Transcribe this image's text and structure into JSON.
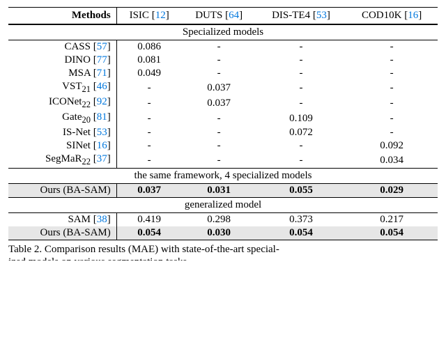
{
  "header": {
    "methods": "Methods",
    "cols": [
      {
        "name": "ISIC",
        "cite": "12"
      },
      {
        "name": "DUTS",
        "cite": "64"
      },
      {
        "name": "DIS-TE4",
        "cite": "53"
      },
      {
        "name": "COD10K",
        "cite": "16"
      }
    ]
  },
  "sections": [
    {
      "title": "Specialized models",
      "shade": false,
      "rows": [
        {
          "name": "CASS",
          "cite": "57",
          "vals": [
            "0.086",
            "-",
            "-",
            "-"
          ],
          "bold": false
        },
        {
          "name": "DINO",
          "cite": "77",
          "vals": [
            "0.081",
            "-",
            "-",
            "-"
          ],
          "bold": false
        },
        {
          "name": "MSA",
          "cite": "71",
          "vals": [
            "0.049",
            "-",
            "-",
            "-"
          ],
          "bold": false
        },
        {
          "name": "VST",
          "sub": "21",
          "cite": "46",
          "vals": [
            "-",
            "0.037",
            "-",
            "-"
          ],
          "bold": false
        },
        {
          "name": "ICONet",
          "sub": "22",
          "cite": "92",
          "vals": [
            "-",
            "0.037",
            "-",
            "-"
          ],
          "bold": false
        },
        {
          "name": "Gate",
          "sub": "20",
          "cite": "81",
          "vals": [
            "-",
            "-",
            "0.109",
            "-"
          ],
          "bold": false
        },
        {
          "name": "IS-Net",
          "cite": "53",
          "vals": [
            "-",
            "-",
            "0.072",
            "-"
          ],
          "bold": false
        },
        {
          "name": "SINet",
          "cite": "16",
          "vals": [
            "-",
            "-",
            "-",
            "0.092"
          ],
          "bold": false
        },
        {
          "name": "SegMaR",
          "sub": "22",
          "cite": "37",
          "vals": [
            "-",
            "-",
            "-",
            "0.034"
          ],
          "bold": false
        }
      ]
    },
    {
      "title": "the same framework, 4 specialized models",
      "shade": true,
      "rows": [
        {
          "name": "Ours (BA-SAM)",
          "vals": [
            "0.037",
            "0.031",
            "0.055",
            "0.029"
          ],
          "bold": true
        }
      ]
    },
    {
      "title": "generalized model",
      "shade": false,
      "rows": [
        {
          "name": "SAM",
          "cite": "38",
          "vals": [
            "0.419",
            "0.298",
            "0.373",
            "0.217"
          ],
          "bold": false
        }
      ]
    },
    {
      "shade": true,
      "rows": [
        {
          "name": "Ours (BA-SAM)",
          "vals": [
            "0.054",
            "0.030",
            "0.054",
            "0.054"
          ],
          "bold": true
        }
      ]
    }
  ],
  "caption": {
    "label": "Table 2.",
    "text": "Comparison results (MAE) with state-of-the-art special-",
    "cutoff": "ized models on various segmentation tasks"
  }
}
